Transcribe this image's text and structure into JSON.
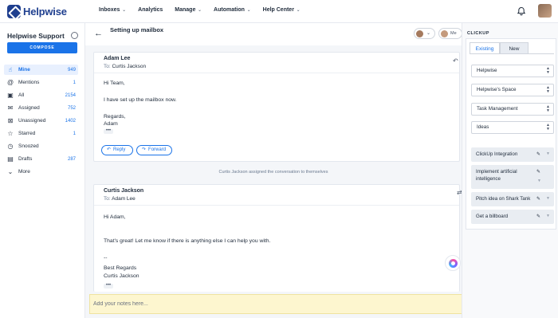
{
  "app": {
    "name": "Helpwise"
  },
  "nav": {
    "items": [
      {
        "label": "Inboxes",
        "chevron": true
      },
      {
        "label": "Analytics",
        "chevron": false
      },
      {
        "label": "Manage",
        "chevron": true
      },
      {
        "label": "Automation",
        "chevron": true
      },
      {
        "label": "Help Center",
        "chevron": true
      }
    ]
  },
  "sidebar": {
    "title": "Helpwise Support",
    "compose_label": "COMPOSE",
    "folders": [
      {
        "label": "Mine",
        "count": "949",
        "icon": "hand-icon",
        "active": true
      },
      {
        "label": "Mentions",
        "count": "1",
        "icon": "at-icon",
        "active": false
      },
      {
        "label": "All",
        "count": "2154",
        "icon": "inbox-icon",
        "active": false
      },
      {
        "label": "Assigned",
        "count": "752",
        "icon": "mail-icon",
        "active": false
      },
      {
        "label": "Unassigned",
        "count": "1402",
        "icon": "unassigned-icon",
        "active": false
      },
      {
        "label": "Starred",
        "count": "1",
        "icon": "star-icon",
        "active": false
      },
      {
        "label": "Snoozed",
        "count": "",
        "icon": "clock-icon",
        "active": false
      },
      {
        "label": "Drafts",
        "count": "287",
        "icon": "draft-icon",
        "active": false
      },
      {
        "label": "More",
        "count": "",
        "icon": "chevron-down-icon",
        "active": false
      }
    ]
  },
  "conversation": {
    "title": "Setting up mailbox",
    "assignee_short": "Me",
    "messages": [
      {
        "sender": "Adam Lee",
        "to_label": "To:",
        "to": "Curtis Jackson",
        "lines": [
          "Hi Team,",
          "I have set up the mailbox now.",
          "Regards,",
          "Adam"
        ],
        "reply_label": "Reply",
        "forward_label": "Forward"
      },
      {
        "sender": "Curtis Jackson",
        "to_label": "To:",
        "to": "Adam Lee",
        "lines": [
          "Hi Adam,",
          "That's great! Let me know if there is anything else I can help you with.",
          "--",
          "Best Regards",
          "Curtis Jackson"
        ]
      }
    ],
    "system_note": "Curtis Jackson assigned the conversation to themselves",
    "notes_placeholder": "Add your notes here..."
  },
  "clickup": {
    "title": "CLICKUP",
    "tabs": [
      {
        "label": "Existing",
        "active": true
      },
      {
        "label": "New",
        "active": false
      }
    ],
    "selects": [
      "Helpwise",
      "Helpwise's Space",
      "Task Management",
      "Ideas"
    ],
    "tasks": [
      {
        "name": "ClickUp Integration"
      },
      {
        "name": "Implement artificial intelligence"
      },
      {
        "name": "Pitch idea on Shark Tank"
      },
      {
        "name": "Get a billboard"
      }
    ]
  },
  "colors": {
    "brand": "#1f3f8f",
    "accent": "#1a73e8",
    "notes_bg": "#fdf6cf"
  }
}
